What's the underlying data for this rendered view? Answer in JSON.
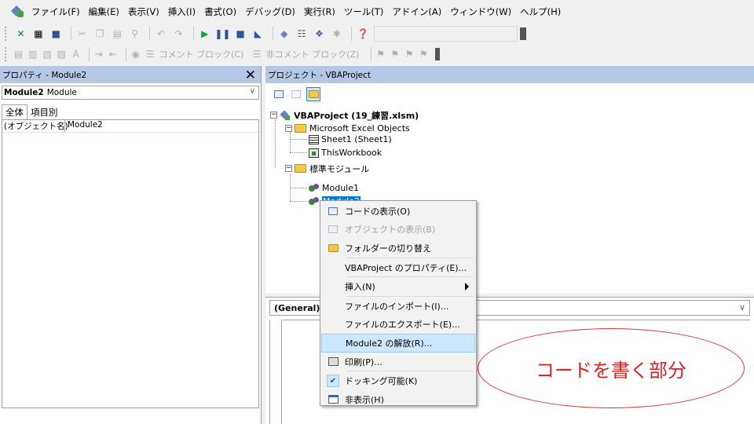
{
  "menu": {
    "items": [
      "ファイル(F)",
      "編集(E)",
      "表示(V)",
      "挿入(I)",
      "書式(O)",
      "デバッグ(D)",
      "実行(R)",
      "ツール(T)",
      "アドイン(A)",
      "ウィンドウ(W)",
      "ヘルプ(H)"
    ]
  },
  "toolbar2": {
    "comment_block": "コメント ブロック(C)",
    "uncomment_block": "非コメント ブロック(Z)"
  },
  "properties": {
    "title": "プロパティ - Module2",
    "object_name": "Module2",
    "object_type": "Module",
    "tabs": [
      "全体",
      "項目別"
    ],
    "rows": [
      {
        "name": "(オブジェクト名)",
        "value": "Module2"
      }
    ]
  },
  "project": {
    "title": "プロジェクト - VBAProject",
    "root": "VBAProject (19_練習.xlsm)",
    "excel_objects": "Microsoft Excel Objects",
    "sheet1": "Sheet1 (Sheet1)",
    "thisworkbook": "ThisWorkbook",
    "std_modules": "標準モジュール",
    "module1": "Module1",
    "module2": "Module2"
  },
  "code": {
    "object_combo": "(General)"
  },
  "context_menu": {
    "items": [
      {
        "label": "コードの表示(O)",
        "icon": "code-view-icon",
        "disabled": false
      },
      {
        "label": "オブジェクトの表示(B)",
        "icon": "object-view-icon",
        "disabled": true
      },
      {
        "label": "フォルダーの切り替え",
        "icon": "folder-icon",
        "disabled": false
      },
      {
        "label": "VBAProject のプロパティ(E)...",
        "icon": "",
        "disabled": false
      },
      {
        "label": "挿入(N)",
        "icon": "",
        "disabled": false,
        "submenu": true
      },
      {
        "label": "ファイルのインポート(I)...",
        "icon": "",
        "disabled": false
      },
      {
        "label": "ファイルのエクスポート(E)...",
        "icon": "",
        "disabled": false
      },
      {
        "label": "Module2 の解放(R)...",
        "icon": "",
        "disabled": false,
        "highlighted": true
      },
      {
        "label": "印刷(P)...",
        "icon": "printer-icon",
        "disabled": false
      },
      {
        "label": "ドッキング可能(K)",
        "icon": "check-icon",
        "disabled": false,
        "checked": true
      },
      {
        "label": "非表示(H)",
        "icon": "window-icon",
        "disabled": false
      }
    ]
  },
  "annotation": {
    "text": "コードを書く部分",
    "color": "#e02020"
  }
}
